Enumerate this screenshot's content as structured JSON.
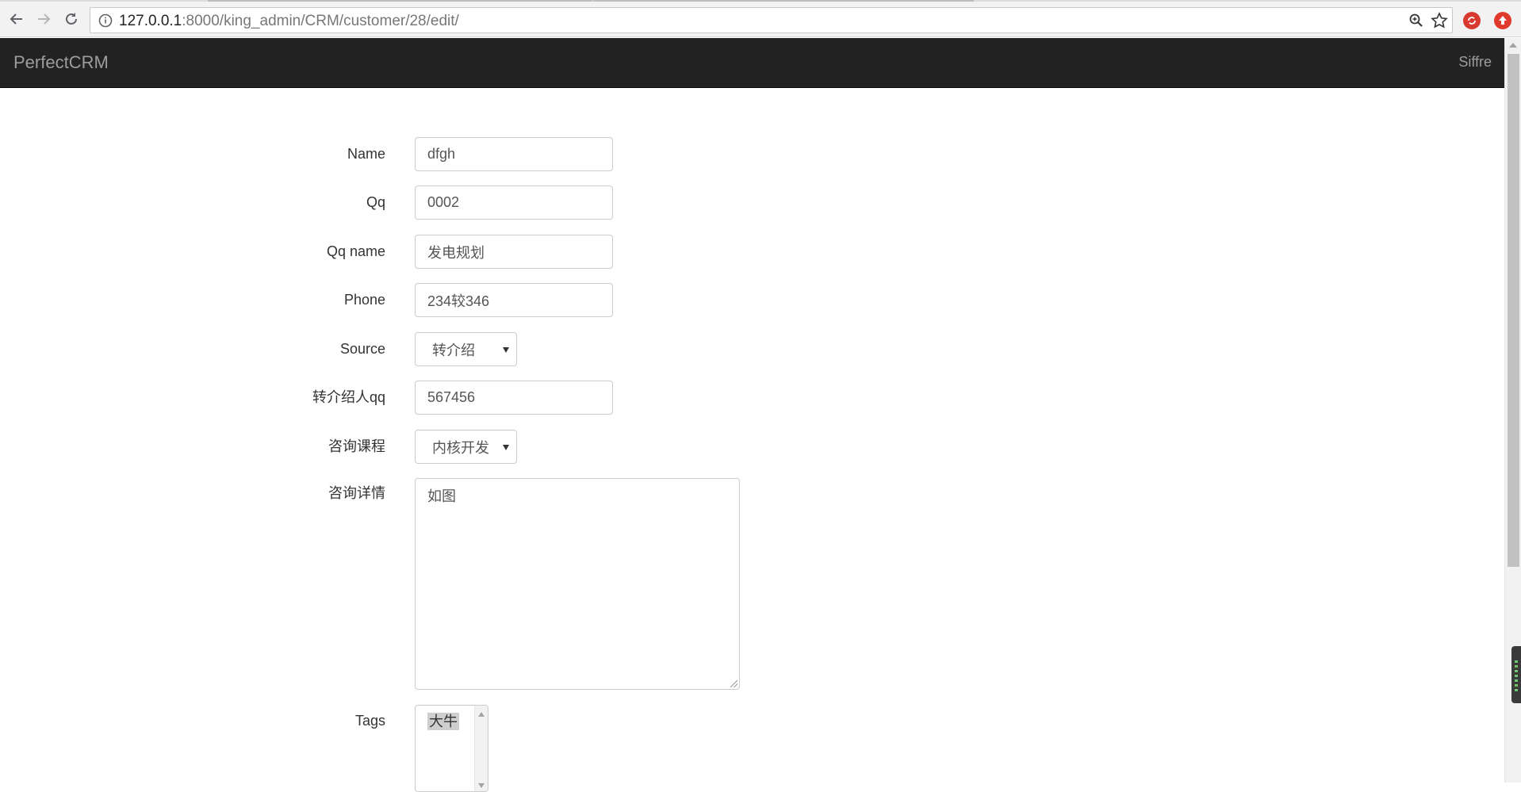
{
  "browser": {
    "url_host": "127.0.0.1",
    "url_rest": ":8000/king_admin/CRM/customer/28/edit/"
  },
  "navbar": {
    "brand": "PerfectCRM",
    "user": "Siffre"
  },
  "form": {
    "name": {
      "label": "Name",
      "value": "dfgh"
    },
    "qq": {
      "label": "Qq",
      "value": "0002"
    },
    "qq_name": {
      "label": "Qq name",
      "value": "发电规划"
    },
    "phone": {
      "label": "Phone",
      "value": "234较346"
    },
    "source": {
      "label": "Source",
      "selected": "转介绍"
    },
    "referral_qq": {
      "label": "转介绍人qq",
      "value": "567456"
    },
    "consult_course": {
      "label": "咨询课程",
      "selected": "内核开发"
    },
    "consult_detail": {
      "label": "咨询详情",
      "value": "如图"
    },
    "tags": {
      "label": "Tags",
      "options": [
        "大牛"
      ]
    }
  },
  "colors": {
    "navbar_bg": "#222222",
    "navbar_text": "#9d9d9d",
    "input_border": "#cccccc"
  }
}
